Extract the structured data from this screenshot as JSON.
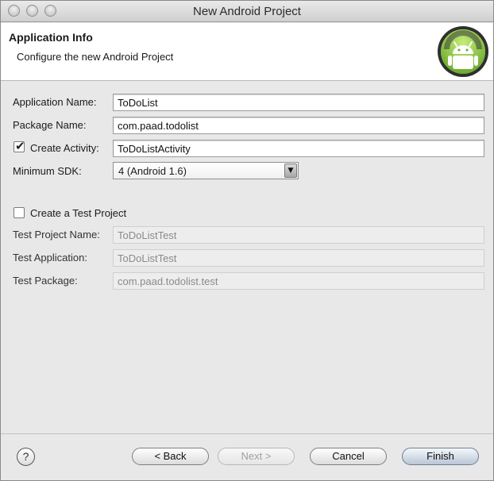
{
  "window": {
    "title": "New Android Project"
  },
  "header": {
    "title": "Application Info",
    "subtitle": "Configure the new Android Project"
  },
  "form": {
    "application_name": {
      "label": "Application Name:",
      "value": "ToDoList"
    },
    "package_name": {
      "label": "Package Name:",
      "value": "com.paad.todolist"
    },
    "create_activity": {
      "label": "Create Activity:",
      "checked": true,
      "value": "ToDoListActivity"
    },
    "minimum_sdk": {
      "label": "Minimum SDK:",
      "value": "4 (Android 1.6)"
    },
    "create_test_project": {
      "label": "Create a Test Project",
      "checked": false
    },
    "test_project_name": {
      "label": "Test Project Name:",
      "value": "ToDoListTest"
    },
    "test_application": {
      "label": "Test Application:",
      "value": "ToDoListTest"
    },
    "test_package": {
      "label": "Test Package:",
      "value": "com.paad.todolist.test"
    }
  },
  "footer": {
    "help_label": "?",
    "back_label": "< Back",
    "next_label": "Next >",
    "cancel_label": "Cancel",
    "finish_label": "Finish"
  },
  "colors": {
    "android_green": "#8cc63e",
    "logo_ring": "#2f2f2f"
  }
}
